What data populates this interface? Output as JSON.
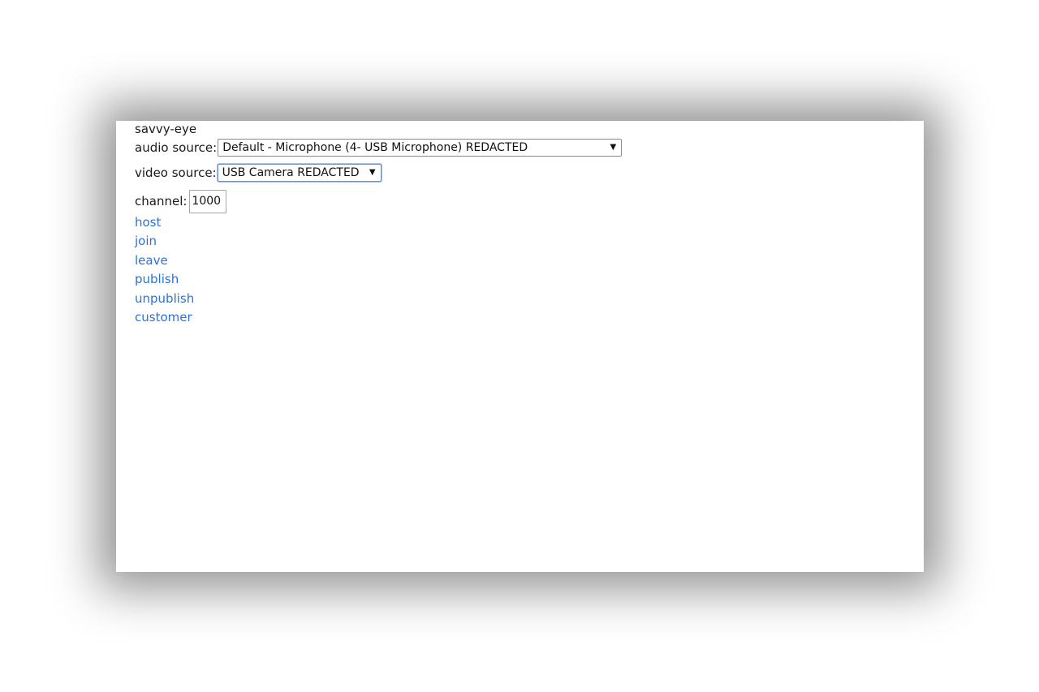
{
  "app": {
    "title": "savvy-eye"
  },
  "audio": {
    "label": "audio source:",
    "selected": "Default - Microphone (4- USB Microphone) REDACTED"
  },
  "video": {
    "label": "video source:",
    "selected": "USB Camera REDACTED"
  },
  "channel": {
    "label": "channel:",
    "value": "1000"
  },
  "links": {
    "host": "host",
    "join": "join",
    "leave": "leave",
    "publish": "publish",
    "unpublish": "unpublish",
    "customer": "customer"
  },
  "icons": {
    "dropdown": "chevron-down-icon"
  },
  "colors": {
    "link": "#2a73d9",
    "focus_border": "#6d8fd0"
  }
}
